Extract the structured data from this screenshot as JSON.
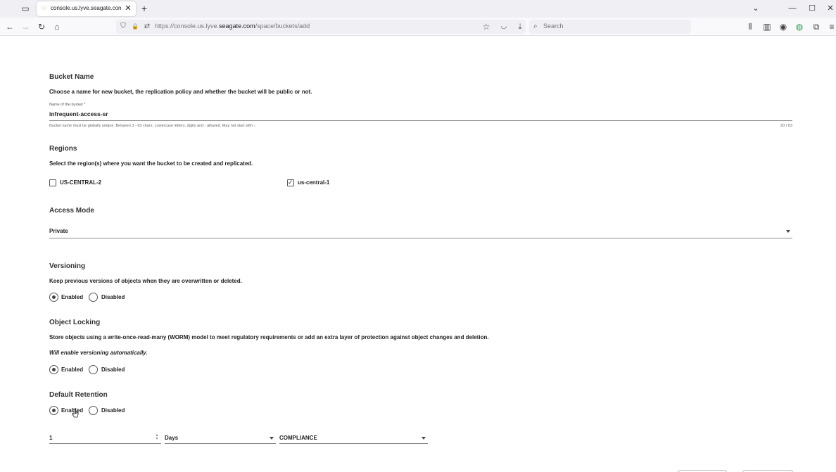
{
  "browser": {
    "tab_title": "console.us.lyve.seagate.com/sp",
    "url_prefix": "https://console.us.lyve.",
    "url_domain": "seagate.com",
    "url_path": "/space/buckets/add",
    "search_placeholder": "Search"
  },
  "icons": {
    "list_all_tabs": "▭",
    "favicon": "◌",
    "close": "✕",
    "new_tab": "+",
    "chevron": "⌄",
    "minimize": "—",
    "maximize": "☐",
    "back": "←",
    "forward": "→",
    "reload": "↻",
    "home": "⌂",
    "shield": "⛉",
    "lock": "🔒",
    "permissions": "⇄",
    "bookmark_star": "☆",
    "pocket": "◡",
    "download": "⤓",
    "search": "⌕",
    "library": "⫴",
    "containers": "▥",
    "account": "◉",
    "extension": "◍",
    "extensions_puzzle": "⧉",
    "menu": "≡"
  },
  "bucket_name": {
    "title": "Bucket Name",
    "description": "Choose a name for new bucket, the replication policy and whether the bucket will be public or not.",
    "field_label": "Name of the bucket *",
    "value": "infrequent-access-sr",
    "hint": "Bucket name must be globally unique. Between 3 - 63 chars. Lowercase letters, digits and - allowed. May not start with -.",
    "counter": "20 / 63"
  },
  "regions": {
    "title": "Regions",
    "description": "Select the region(s) where you want the bucket to be created and replicated.",
    "options": [
      {
        "label": "US-CENTRAL-2",
        "checked": false
      },
      {
        "label": "us-central-1",
        "checked": true
      }
    ]
  },
  "access_mode": {
    "title": "Access Mode",
    "value": "Private"
  },
  "versioning": {
    "title": "Versioning",
    "description": "Keep previous versions of objects when they are overwritten or deleted.",
    "enabled_label": "Enabled",
    "disabled_label": "Disabled",
    "selected": "Enabled"
  },
  "object_locking": {
    "title": "Object Locking",
    "description": "Store objects using a write-once-read-many (WORM) model to meet regulatory requirements or add an extra layer of protection against object changes and deletion.",
    "note": "Will enable versioning automatically.",
    "enabled_label": "Enabled",
    "disabled_label": "Disabled",
    "selected": "Enabled"
  },
  "default_retention": {
    "title": "Default Retention",
    "enabled_label": "Enabled",
    "disabled_label": "Disabled",
    "selected": "Enabled",
    "period_value": "1",
    "period_unit": "Days",
    "mode": "COMPLIANCE"
  }
}
